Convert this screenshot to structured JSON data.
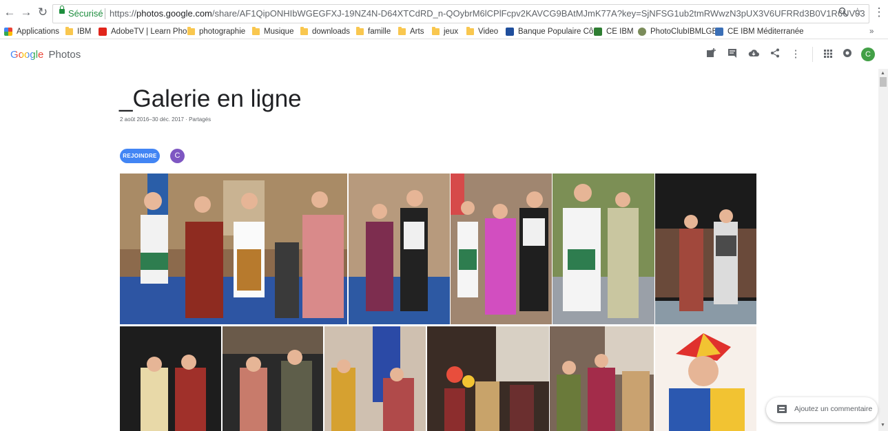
{
  "browser": {
    "secure_label": "Sécurisé",
    "url_scheme": "https://",
    "url_host": "photos.google.com",
    "url_path": "/share/AF1QipONHIbWGEGFXJ-19NZ4N-D64XTCdRD_n-QOybrM6lCPlFcpv2KAVCG9BAtMJmK77A?key=SjNFSG1ub2tmRWwzN3pUX3V6UFRRd3B0V1R6UV93"
  },
  "bookmarks": [
    {
      "label": "Applications",
      "icon": "apps-grid-icon"
    },
    {
      "label": "IBM",
      "icon": "folder-icon"
    },
    {
      "label": "AdobeTV | Learn Pho",
      "icon": "adobe-icon"
    },
    {
      "label": "photographie",
      "icon": "folder-icon"
    },
    {
      "label": "Musique",
      "icon": "folder-icon"
    },
    {
      "label": "downloads",
      "icon": "folder-icon"
    },
    {
      "label": "famille",
      "icon": "folder-icon"
    },
    {
      "label": "Arts",
      "icon": "folder-icon"
    },
    {
      "label": "jeux",
      "icon": "folder-icon"
    },
    {
      "label": "Video",
      "icon": "folder-icon"
    },
    {
      "label": "Banque Populaire Cô",
      "icon": "bank-icon"
    },
    {
      "label": "CE IBM",
      "icon": "ce-ibm-icon"
    },
    {
      "label": "PhotoClubIBMLGE",
      "icon": "photoclub-icon"
    },
    {
      "label": "CE IBM Méditerranée",
      "icon": "ce-ibm-med-icon"
    }
  ],
  "app": {
    "logo_google": "Google",
    "logo_photos": "Photos",
    "user_initial": "C"
  },
  "album": {
    "title": "_Galerie en ligne",
    "meta": "2 août 2016–30 déc. 2017 · Partagés",
    "join_label": "REJOINDRE",
    "member_initial": "C"
  },
  "comment": {
    "placeholder": "Ajoutez un commentaire"
  },
  "colors": {
    "accent": "#4285f4",
    "secure": "#1e8e3e",
    "user_avatar": "#43a047",
    "member_avatar": "#7e57c2"
  }
}
